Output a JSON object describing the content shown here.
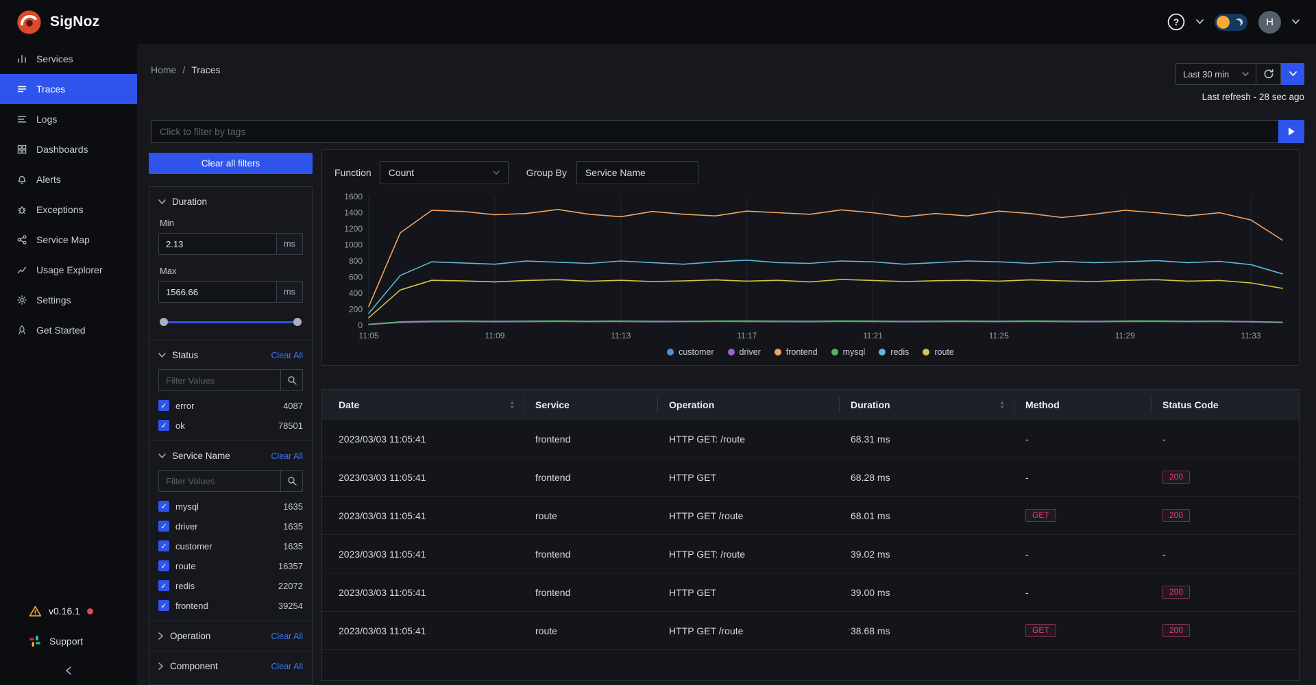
{
  "brand": {
    "name": "SigNoz"
  },
  "header": {
    "avatar_initial": "H",
    "icons": [
      "help-icon",
      "chevron-down-icon",
      "theme-toggle",
      "avatar"
    ]
  },
  "sidebar": {
    "items": [
      {
        "label": "Services",
        "icon": "bar-chart"
      },
      {
        "label": "Traces",
        "icon": "list-lines"
      },
      {
        "label": "Logs",
        "icon": "text-lines"
      },
      {
        "label": "Dashboards",
        "icon": "grid"
      },
      {
        "label": "Alerts",
        "icon": "bell"
      },
      {
        "label": "Exceptions",
        "icon": "bug"
      },
      {
        "label": "Service Map",
        "icon": "node-graph"
      },
      {
        "label": "Usage Explorer",
        "icon": "trend-line"
      },
      {
        "label": "Settings",
        "icon": "gear"
      },
      {
        "label": "Get Started",
        "icon": "rocket"
      }
    ],
    "active_item": "Traces",
    "version": "v0.16.1",
    "support_label": "Support"
  },
  "breadcrumb": {
    "home": "Home",
    "separator": "/",
    "current": "Traces"
  },
  "time_controls": {
    "range_label": "Last 30 min",
    "last_refresh": "Last refresh - 28 sec ago"
  },
  "search": {
    "placeholder": "Click to filter by tags"
  },
  "filters": {
    "clear_all_button": "Clear all filters",
    "clear_link": "Clear All",
    "duration": {
      "title": "Duration",
      "min_label": "Min",
      "min_value": "2.13",
      "max_label": "Max",
      "max_value": "1566.66",
      "unit": "ms"
    },
    "status": {
      "title": "Status",
      "filter_placeholder": "Filter Values",
      "options": [
        {
          "label": "error",
          "count": "4087",
          "checked": true
        },
        {
          "label": "ok",
          "count": "78501",
          "checked": true
        }
      ]
    },
    "service_name": {
      "title": "Service Name",
      "filter_placeholder": "Filter Values",
      "options": [
        {
          "label": "mysql",
          "count": "1635",
          "checked": true
        },
        {
          "label": "driver",
          "count": "1635",
          "checked": true
        },
        {
          "label": "customer",
          "count": "1635",
          "checked": true
        },
        {
          "label": "route",
          "count": "16357",
          "checked": true
        },
        {
          "label": "redis",
          "count": "22072",
          "checked": true
        },
        {
          "label": "frontend",
          "count": "39254",
          "checked": true
        }
      ]
    },
    "operation": {
      "title": "Operation"
    },
    "component": {
      "title": "Component"
    }
  },
  "query": {
    "function_label": "Function",
    "function_value": "Count",
    "group_by_label": "Group By",
    "group_by_value": "Service Name"
  },
  "chart_data": {
    "type": "line",
    "title": "Trace count over time grouped by Service Name",
    "xlabel": "",
    "ylabel": "",
    "ylim": [
      0,
      1600
    ],
    "y_ticks": [
      0,
      200,
      400,
      600,
      800,
      1000,
      1200,
      1400,
      1600
    ],
    "x": [
      "11:05",
      "11:06",
      "11:07",
      "11:08",
      "11:09",
      "11:10",
      "11:11",
      "11:12",
      "11:13",
      "11:14",
      "11:15",
      "11:16",
      "11:17",
      "11:18",
      "11:19",
      "11:20",
      "11:21",
      "11:22",
      "11:23",
      "11:24",
      "11:25",
      "11:26",
      "11:27",
      "11:28",
      "11:29",
      "11:30",
      "11:31",
      "11:32",
      "11:33",
      "11:34"
    ],
    "x_tick_labels": [
      "11:05",
      "11:09",
      "11:13",
      "11:17",
      "11:21",
      "11:25",
      "11:29",
      "11:33"
    ],
    "x_tick_indices": [
      0,
      4,
      8,
      12,
      16,
      20,
      24,
      28
    ],
    "grid": "vertical",
    "legend_position": "bottom",
    "series": [
      {
        "name": "customer",
        "color": "#4f8fd9",
        "values": [
          12,
          40,
          48,
          50,
          47,
          49,
          51,
          48,
          50,
          49,
          47,
          50,
          52,
          49,
          48,
          51,
          50,
          47,
          49,
          50,
          48,
          51,
          49,
          47,
          50,
          52,
          48,
          50,
          46,
          38
        ]
      },
      {
        "name": "driver",
        "color": "#9a62d0",
        "values": [
          10,
          36,
          44,
          46,
          44,
          45,
          47,
          45,
          46,
          44,
          45,
          47,
          46,
          45,
          44,
          47,
          46,
          44,
          45,
          46,
          45,
          47,
          45,
          44,
          46,
          47,
          45,
          46,
          42,
          34
        ]
      },
      {
        "name": "frontend",
        "color": "#f2a35e",
        "values": [
          235,
          1150,
          1430,
          1415,
          1375,
          1390,
          1440,
          1380,
          1350,
          1415,
          1380,
          1360,
          1420,
          1400,
          1380,
          1435,
          1400,
          1350,
          1390,
          1360,
          1420,
          1390,
          1340,
          1380,
          1430,
          1400,
          1360,
          1400,
          1310,
          1060
        ]
      },
      {
        "name": "mysql",
        "color": "#55b467",
        "values": [
          14,
          44,
          54,
          55,
          52,
          54,
          56,
          53,
          55,
          53,
          52,
          55,
          56,
          54,
          53,
          56,
          55,
          52,
          54,
          55,
          53,
          56,
          54,
          52,
          55,
          56,
          53,
          55,
          48,
          40
        ]
      },
      {
        "name": "redis",
        "color": "#62b5dc",
        "values": [
          150,
          620,
          790,
          775,
          760,
          800,
          785,
          770,
          800,
          780,
          760,
          790,
          810,
          780,
          770,
          800,
          790,
          760,
          780,
          800,
          790,
          770,
          795,
          780,
          790,
          805,
          780,
          795,
          755,
          640
        ]
      },
      {
        "name": "route",
        "color": "#d6c24e",
        "values": [
          95,
          440,
          560,
          552,
          540,
          558,
          568,
          548,
          560,
          545,
          552,
          565,
          550,
          560,
          540,
          570,
          558,
          545,
          555,
          560,
          550,
          565,
          553,
          545,
          560,
          568,
          550,
          558,
          528,
          460
        ]
      }
    ]
  },
  "table": {
    "columns": [
      "Date",
      "Service",
      "Operation",
      "Duration",
      "Method",
      "Status Code"
    ],
    "rows": [
      {
        "date": "2023/03/03 11:05:41",
        "service": "frontend",
        "operation": "HTTP GET: /route",
        "duration": "68.31 ms",
        "method": "-",
        "status_code": "-"
      },
      {
        "date": "2023/03/03 11:05:41",
        "service": "frontend",
        "operation": "HTTP GET",
        "duration": "68.28 ms",
        "method": "-",
        "status_code": "200"
      },
      {
        "date": "2023/03/03 11:05:41",
        "service": "route",
        "operation": "HTTP GET /route",
        "duration": "68.01 ms",
        "method": "GET",
        "status_code": "200"
      },
      {
        "date": "2023/03/03 11:05:41",
        "service": "frontend",
        "operation": "HTTP GET: /route",
        "duration": "39.02 ms",
        "method": "-",
        "status_code": "-"
      },
      {
        "date": "2023/03/03 11:05:41",
        "service": "frontend",
        "operation": "HTTP GET",
        "duration": "39.00 ms",
        "method": "-",
        "status_code": "200"
      },
      {
        "date": "2023/03/03 11:05:41",
        "service": "route",
        "operation": "HTTP GET /route",
        "duration": "38.68 ms",
        "method": "GET",
        "status_code": "200"
      }
    ]
  }
}
